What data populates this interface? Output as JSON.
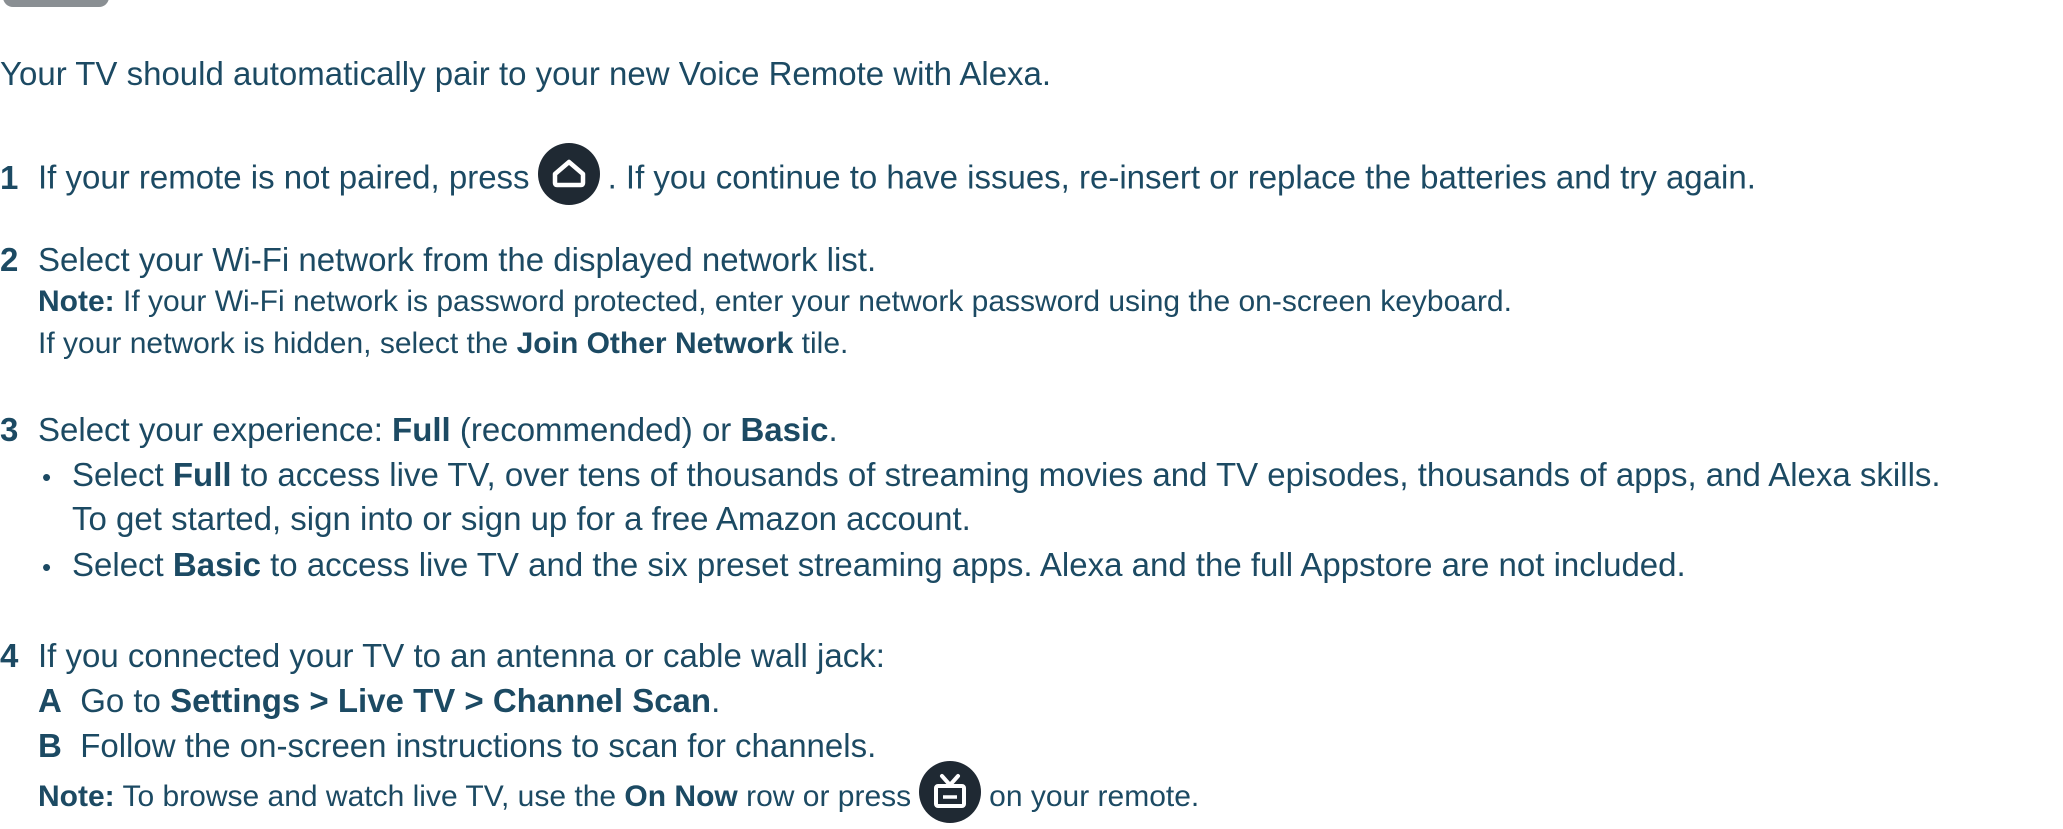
{
  "intro": "Your TV should automatically pair to your new Voice Remote with Alexa.",
  "step1": {
    "num": "1",
    "text_a": "If your remote is not paired, press",
    "icon": "home-icon",
    "text_b": ". If you continue to have issues, re-insert or replace the batteries and try again."
  },
  "step2": {
    "num": "2",
    "text": "Select your Wi-Fi network from the displayed network list.",
    "note_label": "Note:",
    "note_text": "If your Wi-Fi network is password protected, enter your network password using the on-screen keyboard.",
    "hidden_a": "If your network is hidden, select the",
    "hidden_bold": "Join Other Network",
    "hidden_b": "tile."
  },
  "step3": {
    "num": "3",
    "text_a": "Select your experience:",
    "full": "Full",
    "text_b": "(recommended) or",
    "basic": "Basic",
    "period": ".",
    "bullet_char": "•",
    "bullet1_a": "Select",
    "bullet1_bold": "Full",
    "bullet1_b": "to access live TV, over tens of thousands of streaming movies and TV episodes, thousands of apps, and Alexa skills.",
    "bullet1_cont": "To get started, sign into or sign up for a free Amazon account.",
    "bullet2_a": "Select",
    "bullet2_bold": "Basic",
    "bullet2_b": "to access live TV and the six preset streaming apps. Alexa and the full Appstore are not included."
  },
  "step4": {
    "num": "4",
    "text": "If you connected your TV to an antenna or cable wall jack:",
    "a_label": "A",
    "a_text": "Go to",
    "a_bold": "Settings > Live TV > Channel Scan",
    "a_period": ".",
    "b_label": "B",
    "b_text": "Follow the on-screen instructions to scan for channels.",
    "note_label": "Note:",
    "note_a": "To browse and watch live TV, use the",
    "note_bold": "On Now",
    "note_b": "row or press",
    "icon": "live-tv-icon",
    "note_c": "on your remote."
  },
  "colors": {
    "text": "#1c4a63",
    "icon_bg": "#1f2933"
  }
}
